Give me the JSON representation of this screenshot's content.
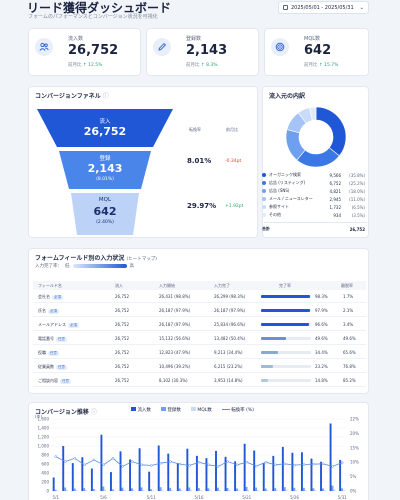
{
  "header": {
    "title": "リード獲得ダッシュボード",
    "subtitle": "フォームのパフォーマンスとコンバージョン状況を可視化",
    "date_range": "2025/05/01 - 2025/05/31"
  },
  "kpis": [
    {
      "label": "流入数",
      "value": "26,752",
      "delta_label": "前月比",
      "delta": "↑ 12.5%",
      "icon": "users-icon"
    },
    {
      "label": "登録数",
      "value": "2,143",
      "delta_label": "前月比",
      "delta": "↑ 8.3%",
      "icon": "pencil-icon"
    },
    {
      "label": "MQL数",
      "value": "642",
      "delta_label": "前月比",
      "delta": "↑ 15.7%",
      "icon": "target-icon"
    }
  ],
  "funnel": {
    "title": "コンバージョンファネル",
    "col_rate": "転換率",
    "col_mom": "前月比",
    "stages": [
      {
        "name": "流入",
        "value": "26,752",
        "sub": ""
      },
      {
        "name": "登録",
        "value": "2,143",
        "sub": "(8.01%)"
      },
      {
        "name": "MQL",
        "value": "642",
        "sub": "(2.40%)"
      }
    ],
    "rates": [
      {
        "rate": "8.01%",
        "mom": "-0.34pt"
      },
      {
        "rate": "29.97%",
        "mom": "+1.92pt"
      }
    ]
  },
  "sources": {
    "title": "流入元の内訳",
    "items": [
      {
        "name": "オーガニック検索",
        "value": "9,566",
        "pct": "(35.8%)",
        "share": 35.8,
        "color": "#1f57d6"
      },
      {
        "name": "広告 (リスティング)",
        "value": "6,752",
        "pct": "(25.2%)",
        "share": 25.2,
        "color": "#3a78e6"
      },
      {
        "name": "広告 (SNS)",
        "value": "4,821",
        "pct": "(18.0%)",
        "share": 18.0,
        "color": "#6fa0ef"
      },
      {
        "name": "メール / ニュースレター",
        "value": "2,945",
        "pct": "(11.0%)",
        "share": 11.0,
        "color": "#a5c3f5"
      },
      {
        "name": "参照サイト",
        "value": "1,732",
        "pct": "(6.5%)",
        "share": 6.5,
        "color": "#c9dbf8"
      },
      {
        "name": "その他",
        "value": "934",
        "pct": "(3.5%)",
        "share": 3.5,
        "color": "#e1eafb"
      }
    ],
    "total_label": "合計",
    "total_value": "26,752"
  },
  "form": {
    "title": "フォームフィールド別の入力状況",
    "title_suffix": "(ヒートマップ)",
    "scale_label": "入力完了率：",
    "scale_low": "低",
    "scale_high": "高",
    "columns": [
      "フィールド名",
      "流入",
      "入力開始",
      "入力完了",
      "完了率",
      "離脱率"
    ],
    "rows": [
      {
        "name": "会社名",
        "tag": "必須",
        "inflow": "26,752",
        "start": "26,431 (98.8%)",
        "done": "26,299 (98.3%)",
        "rate": "98.3%",
        "rate_num": 98.3,
        "drop": "1.7%"
      },
      {
        "name": "氏名",
        "tag": "必須",
        "inflow": "26,752",
        "start": "26,187 (97.9%)",
        "done": "26,187 (97.9%)",
        "rate": "97.9%",
        "rate_num": 97.9,
        "drop": "2.1%"
      },
      {
        "name": "メールアドレス",
        "tag": "必須",
        "inflow": "26,752",
        "start": "26,187 (97.9%)",
        "done": "25,834 (96.6%)",
        "rate": "96.6%",
        "rate_num": 96.6,
        "drop": "3.4%"
      },
      {
        "name": "電話番号",
        "tag": "任意",
        "inflow": "26,752",
        "start": "15,132 (56.6%)",
        "done": "13,482 (50.4%)",
        "rate": "49.6%",
        "rate_num": 49.6,
        "drop": "49.6%"
      },
      {
        "name": "役職",
        "tag": "任意",
        "inflow": "26,752",
        "start": "12,823 (47.9%)",
        "done": "9,213 (34.4%)",
        "rate": "34.4%",
        "rate_num": 34.4,
        "drop": "65.6%"
      },
      {
        "name": "従業員数",
        "tag": "任意",
        "inflow": "26,752",
        "start": "10,496 (39.2%)",
        "done": "6,215 (23.2%)",
        "rate": "23.2%",
        "rate_num": 23.2,
        "drop": "76.8%"
      },
      {
        "name": "ご相談内容",
        "tag": "任意",
        "inflow": "26,752",
        "start": "8,102 (30.3%)",
        "done": "3,953 (14.8%)",
        "rate": "14.8%",
        "rate_num": 14.8,
        "drop": "85.2%"
      }
    ]
  },
  "chart_data": {
    "type": "bar",
    "title": "コンバージョン推移",
    "legend": [
      "流入数",
      "登録数",
      "MQL数",
      "転換率 (%)"
    ],
    "y_left_ticks": [
      "1,600",
      "1,400",
      "1,200",
      "1,000",
      "800",
      "600",
      "400",
      "200",
      "0"
    ],
    "y_left_label": "(件)",
    "y_right_ticks": [
      "22%",
      "20%",
      "15%",
      "10%",
      "5%",
      "0%"
    ],
    "ylim": [
      0,
      1600
    ],
    "x_ticks": [
      "5/1",
      "5/6",
      "5/11",
      "5/16",
      "5/21",
      "5/26",
      "5/31"
    ],
    "series": [
      {
        "name": "流入数",
        "values": [
          300,
          1000,
          620,
          750,
          500,
          1250,
          420,
          880,
          700,
          950,
          430,
          1010,
          830,
          620,
          940,
          780,
          730,
          890,
          760,
          660,
          1050,
          900,
          620,
          780,
          980,
          850,
          860,
          720,
          650,
          1500,
          690
        ]
      },
      {
        "name": "登録数",
        "values": [
          25,
          80,
          55,
          65,
          45,
          100,
          35,
          75,
          60,
          80,
          40,
          85,
          70,
          55,
          80,
          65,
          60,
          75,
          65,
          55,
          90,
          75,
          55,
          65,
          85,
          70,
          70,
          60,
          55,
          120,
          60
        ]
      },
      {
        "name": "MQL数",
        "values": [
          10,
          25,
          18,
          20,
          15,
          30,
          12,
          22,
          18,
          24,
          12,
          25,
          22,
          17,
          24,
          20,
          18,
          22,
          20,
          16,
          27,
          22,
          16,
          20,
          25,
          21,
          21,
          18,
          16,
          35,
          18
        ]
      },
      {
        "name": "転換率 (%)",
        "values": [
          10.5,
          9.0,
          10.0,
          8.0,
          9.5,
          8.0,
          10.0,
          7.5,
          9.0,
          8.0,
          7.8,
          8.5,
          9.0,
          8.2,
          7.8,
          8.8,
          8.0,
          7.5,
          9.0,
          8.0,
          8.8,
          7.6,
          8.8,
          8.0,
          8.3,
          7.9,
          8.1,
          8.2,
          8.3,
          7.5,
          8.7
        ]
      }
    ]
  }
}
